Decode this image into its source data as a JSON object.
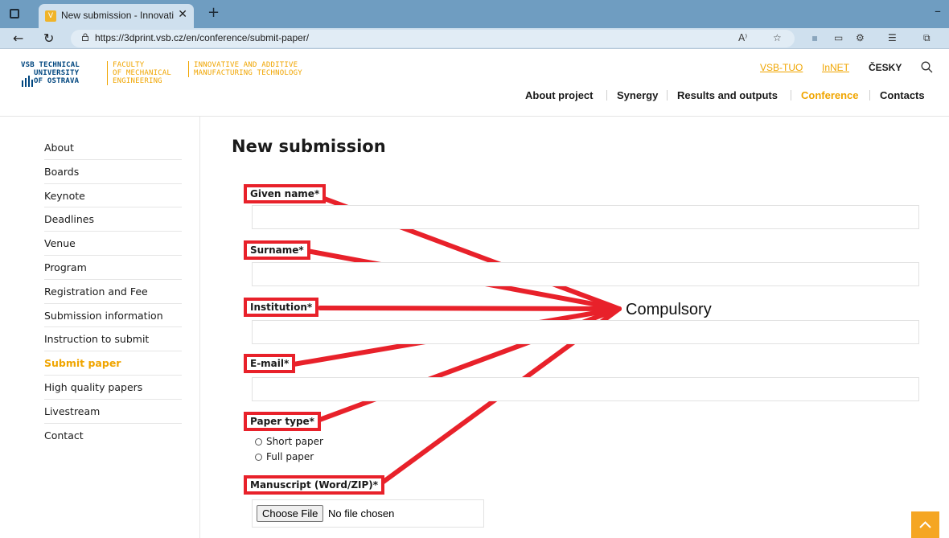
{
  "browser": {
    "tab_title": "New submission - Innovative and Additive Manufacturing",
    "url": "https://3dprint.vsb.cz/en/conference/submit-paper/"
  },
  "header": {
    "logo": {
      "vsb": [
        "VSB TECHNICAL",
        "UNIVERSITY",
        "OF OSTRAVA"
      ],
      "faculty": [
        "FACULTY",
        "OF MECHANICAL",
        "ENGINEERING"
      ],
      "project": [
        "INNOVATIVE AND ADDITIVE",
        "MANUFACTURING TECHNOLOGY"
      ]
    },
    "top_links": [
      "VSB-TUO",
      "InNET"
    ],
    "language": "ČESKY",
    "nav": [
      "About project",
      "Synergy",
      "Results and outputs",
      "Conference",
      "Contacts"
    ],
    "nav_active": "Conference"
  },
  "sidebar": {
    "items": [
      {
        "label": "About"
      },
      {
        "label": "Boards"
      },
      {
        "label": "Keynote"
      },
      {
        "label": "Deadlines"
      },
      {
        "label": "Venue"
      },
      {
        "label": "Program"
      },
      {
        "label": "Registration and Fee"
      },
      {
        "label": "Submission information"
      },
      {
        "label": "Instruction to submit"
      },
      {
        "label": "Submit paper",
        "active": true
      },
      {
        "label": "High quality papers"
      },
      {
        "label": "Livestream"
      },
      {
        "label": "Contact"
      }
    ]
  },
  "form": {
    "title": "New submission",
    "given_name": {
      "label": "Given name*",
      "value": ""
    },
    "surname": {
      "label": "Surname*",
      "value": ""
    },
    "institution": {
      "label": "Institution*",
      "value": ""
    },
    "email": {
      "label": "E-mail*",
      "value": ""
    },
    "paper_type": {
      "label": "Paper type*",
      "options": [
        "Short paper",
        "Full paper"
      ]
    },
    "manuscript": {
      "label": "Manuscript (Word/ZIP)*",
      "button": "Choose File",
      "status": "No file chosen"
    }
  },
  "annotation": {
    "text": "Compulsory",
    "color": "#e8212a"
  },
  "colors": {
    "accent": "#f0a500",
    "brand_blue": "#00467f",
    "annotation_red": "#e8212a"
  }
}
